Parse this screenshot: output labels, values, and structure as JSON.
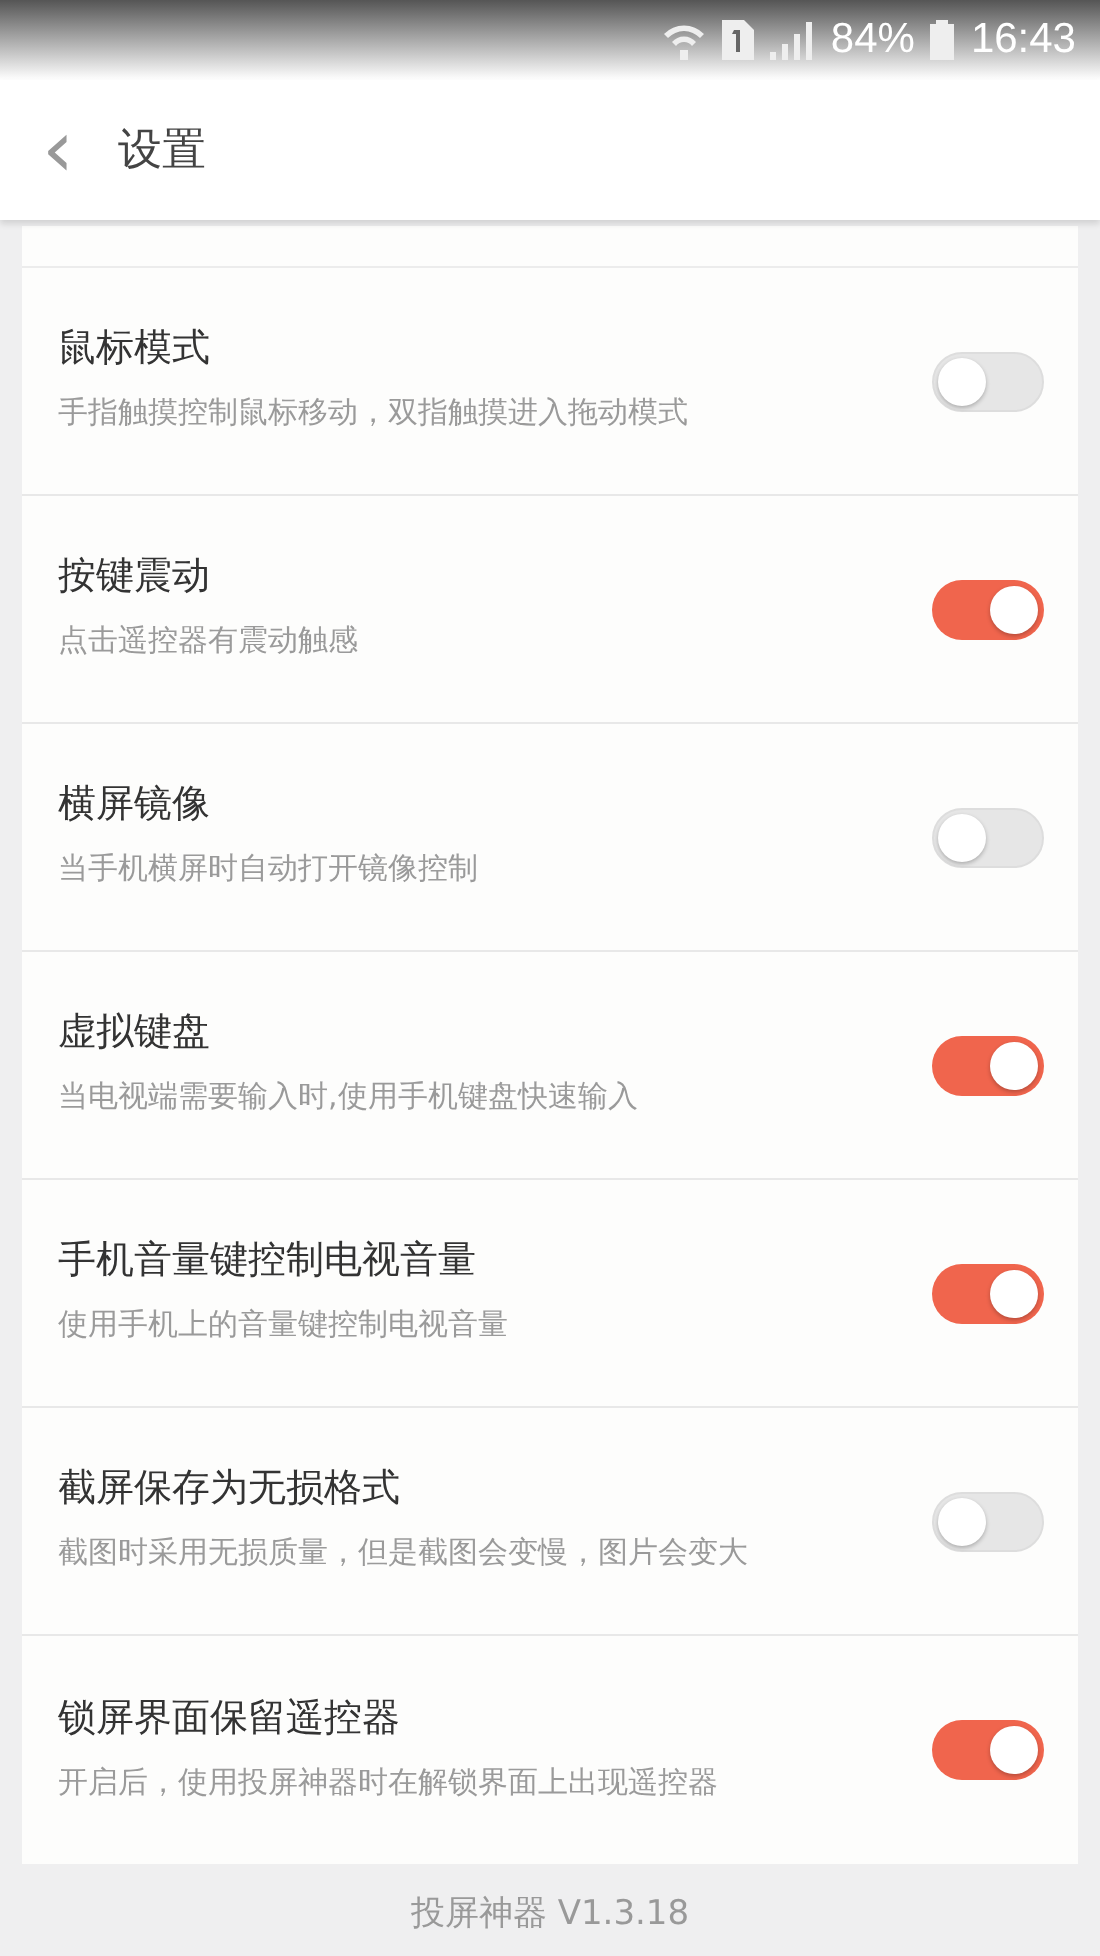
{
  "status_bar": {
    "battery": "84%",
    "time": "16:43"
  },
  "header": {
    "back": "‹",
    "title": "设置"
  },
  "settings": [
    {
      "title": "鼠标模式",
      "description": "手指触摸控制鼠标移动，双指触摸进入拖动模式",
      "on": false
    },
    {
      "title": "按键震动",
      "description": "点击遥控器有震动触感",
      "on": true
    },
    {
      "title": "横屏镜像",
      "description": "当手机横屏时自动打开镜像控制",
      "on": false
    },
    {
      "title": "虚拟键盘",
      "description": "当电视端需要输入时,使用手机键盘快速输入",
      "on": true
    },
    {
      "title": "手机音量键控制电视音量",
      "description": "使用手机上的音量键控制电视音量",
      "on": true
    },
    {
      "title": "截屏保存为无损格式",
      "description": "截图时采用无损质量，但是截图会变慢，图片会变大",
      "on": false
    },
    {
      "title": "锁屏界面保留遥控器",
      "description": "开启后，使用投屏神器时在解锁界面上出现遥控器",
      "on": true
    }
  ],
  "footer": "投屏神器 V1.3.18"
}
